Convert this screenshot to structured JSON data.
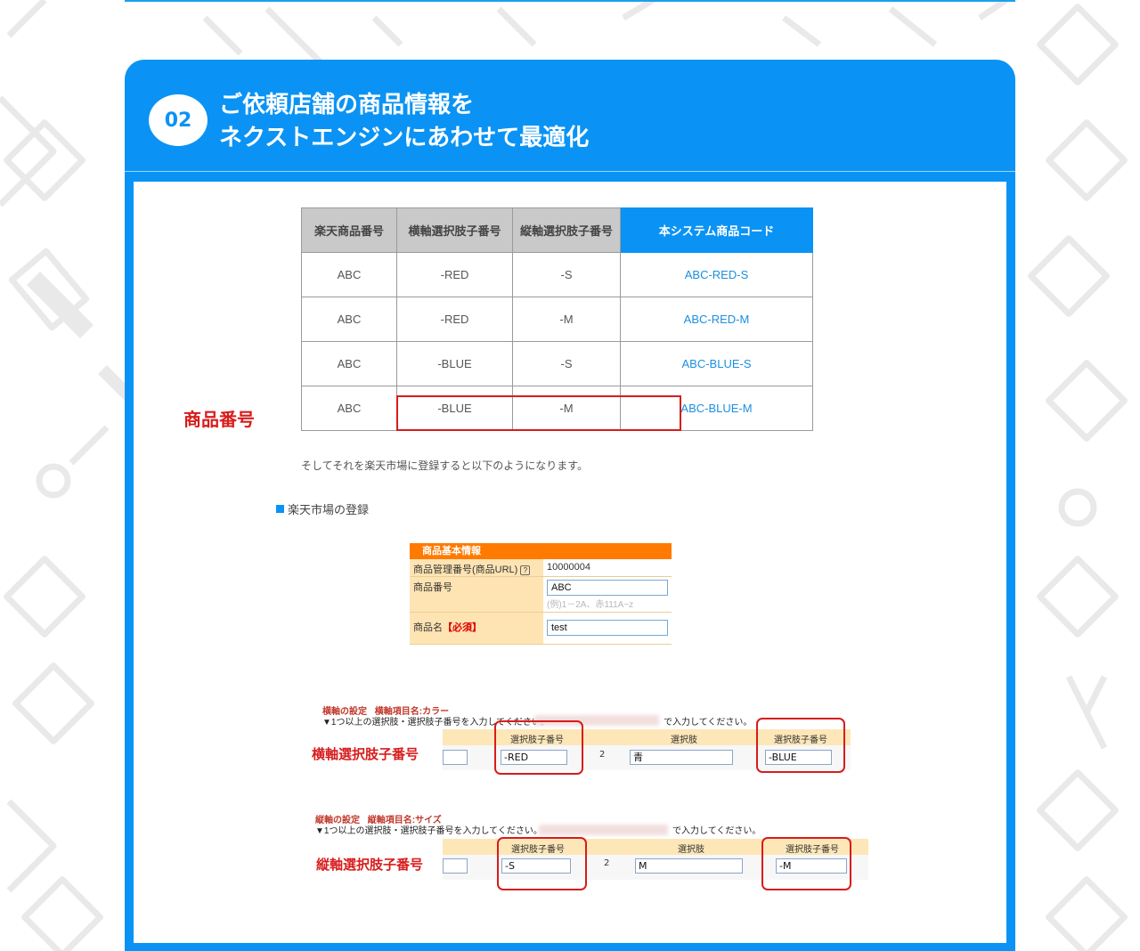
{
  "step": {
    "number": "02",
    "title_line1": "ご依頼店舗の商品情報を",
    "title_line2": "ネクストエンジンにあわせて最適化"
  },
  "table": {
    "headers": [
      "楽天商品番号",
      "横軸選択肢子番号",
      "縦軸選択肢子番号",
      "本システム商品コード"
    ],
    "rows": [
      [
        "ABC",
        "-RED",
        "-S",
        "ABC-RED-S"
      ],
      [
        "ABC",
        "-RED",
        "-M",
        "ABC-RED-M"
      ],
      [
        "ABC",
        "-BLUE",
        "-S",
        "ABC-BLUE-S"
      ],
      [
        "ABC",
        "-BLUE",
        "-M",
        "ABC-BLUE-M"
      ]
    ]
  },
  "note": "そしてそれを楽天市場に登録すると以下のようになります。",
  "section_label": "楽天市場の登録",
  "product_form": {
    "header": "商品基本情報",
    "row1_label": "商品管理番号(商品URL)",
    "row1_value": "10000004",
    "row2_label": "商品番号",
    "row2_value": "ABC",
    "row2_hint": "(例)1－2A、赤111A~z",
    "row3_label": "商品名",
    "row3_required": "【必須】",
    "row3_value": "test",
    "callout": "商品番号"
  },
  "horizontal_axis": {
    "title": "横軸の設定",
    "sub": "横軸項目名:カラー",
    "instruction": "▼1つ以上の選択肢・選択肢子番号を入力してください。",
    "instruction_tail": "で入力してください。",
    "col_child": "選択肢子番号",
    "col_choice": "選択肢",
    "col_child2": "選択肢子番号",
    "index": "2",
    "child1": "-RED",
    "choice2": "青",
    "child2": "-BLUE",
    "callout": "横軸選択肢子番号"
  },
  "vertical_axis": {
    "title": "縦軸の設定",
    "sub": "縦軸項目名:サイズ",
    "instruction": "▼1つ以上の選択肢・選択肢子番号を入力してください。",
    "instruction_tail": "で入力してください。",
    "col_child": "選択肢子番号",
    "col_choice": "選択肢",
    "col_child2": "選択肢子番号",
    "index": "2",
    "child1": "-S",
    "choice2": "M",
    "child2": "-M",
    "callout": "縦軸選択肢子番号"
  },
  "colors": {
    "accent": "#0a93f4",
    "callout_red": "#d81c1c",
    "rakuten_orange": "#ff7a00"
  },
  "icons": [
    "help-icon"
  ]
}
